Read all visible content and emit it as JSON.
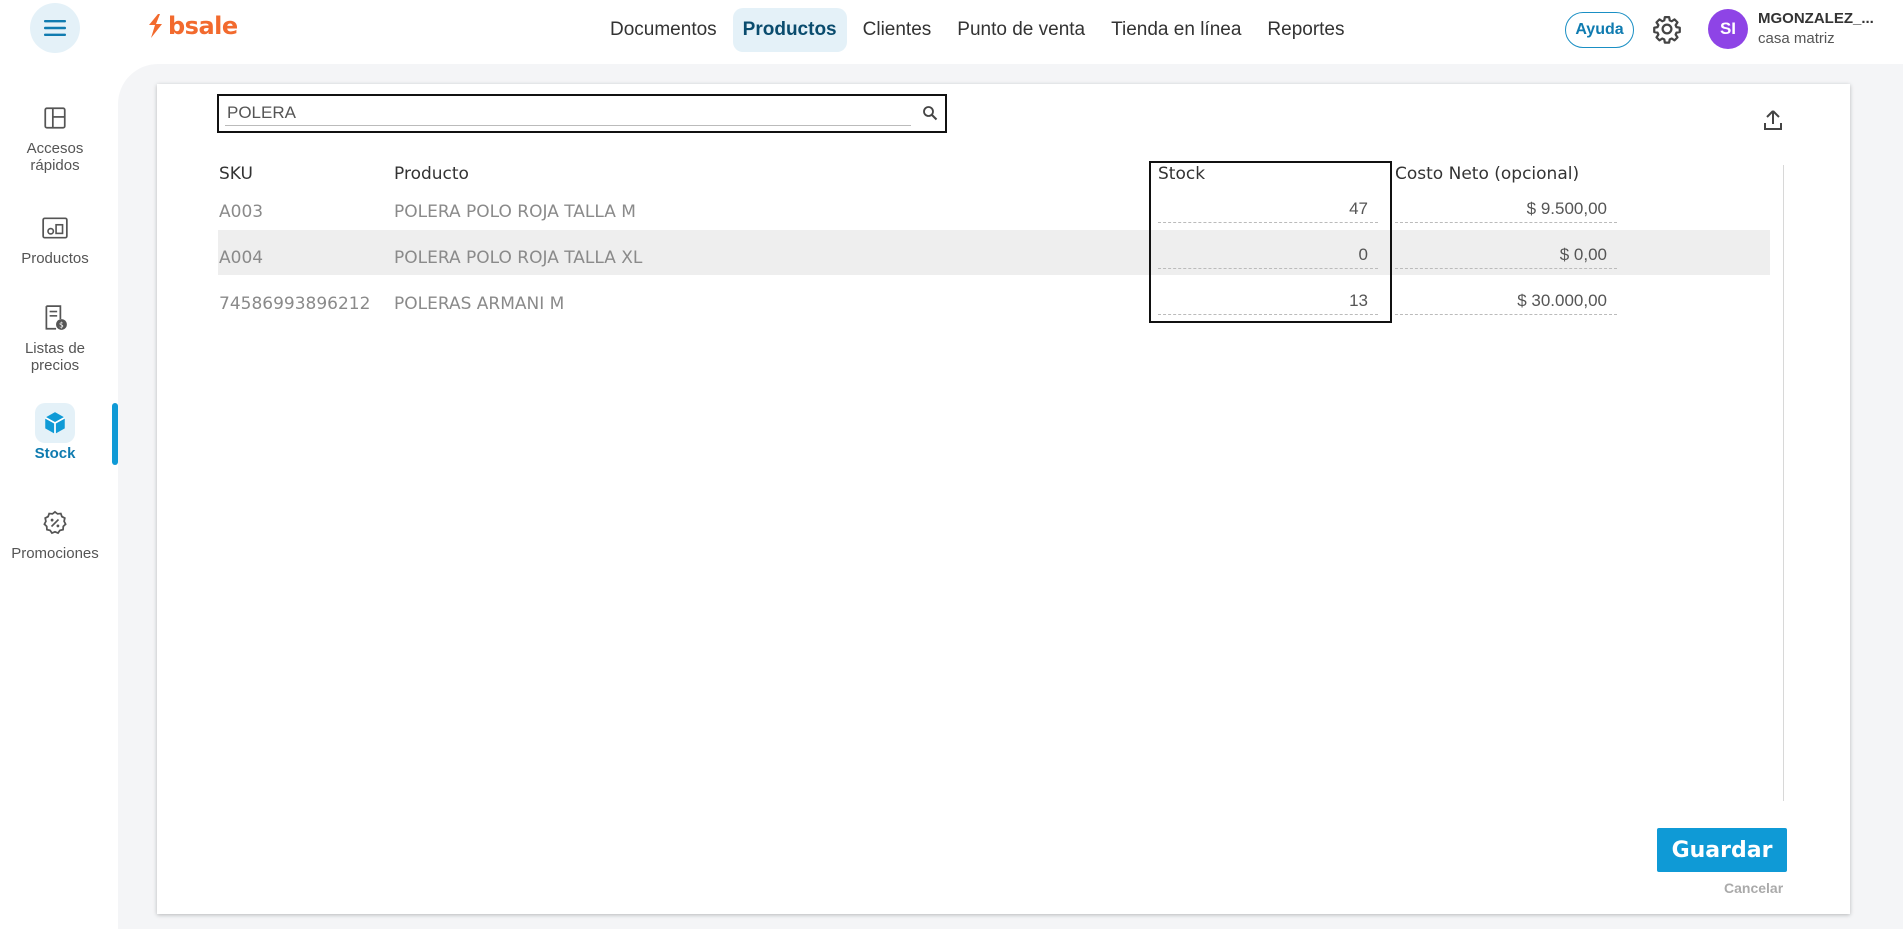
{
  "brand": {
    "name": "bsale",
    "color": "#f26a2e"
  },
  "nav": {
    "items": [
      "Documentos",
      "Productos",
      "Clientes",
      "Punto de venta",
      "Tienda en línea",
      "Reportes"
    ],
    "active": "Productos"
  },
  "header": {
    "help_label": "Ayuda",
    "avatar_initials": "SI",
    "user_name": "MGONZALEZ_...",
    "branch": "casa matriz"
  },
  "sidebar": {
    "items": [
      {
        "label": "Accesos rápidos",
        "icon": "layout-icon"
      },
      {
        "label": "Productos",
        "icon": "products-icon"
      },
      {
        "label": "Listas de precios",
        "icon": "price-list-icon"
      },
      {
        "label": "Stock",
        "icon": "box-icon",
        "active": true
      },
      {
        "label": "Promociones",
        "icon": "discount-icon"
      }
    ]
  },
  "search": {
    "value": "POLERA"
  },
  "table": {
    "headers": {
      "sku": "SKU",
      "product": "Producto",
      "stock": "Stock",
      "cost": "Costo Neto (opcional)"
    },
    "rows": [
      {
        "sku": "A003",
        "product": "POLERA POLO ROJA TALLA M",
        "stock": "47",
        "cost": "$ 9.500,00"
      },
      {
        "sku": "A004",
        "product": "POLERA POLO ROJA TALLA XL",
        "stock": "0",
        "cost": "$ 0,00"
      },
      {
        "sku": "74586993896212",
        "product": "POLERAS ARMANI M",
        "stock": "13",
        "cost": "$ 30.000,00"
      }
    ]
  },
  "actions": {
    "save": "Guardar",
    "cancel": "Cancelar"
  },
  "colors": {
    "accent": "#0f9ad6",
    "avatar": "#8e44e6",
    "active_bg": "#e4f1f8"
  }
}
